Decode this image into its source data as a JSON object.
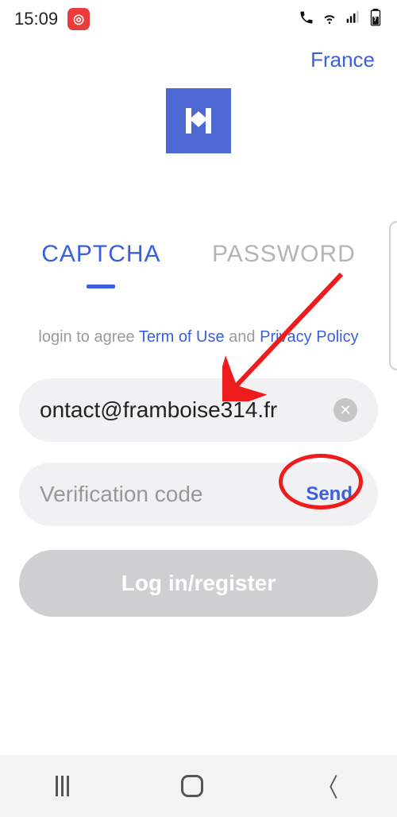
{
  "status": {
    "time": "15:09"
  },
  "top": {
    "region": "France"
  },
  "tabs": {
    "captcha": "CAPTCHA",
    "password": "PASSWORD"
  },
  "agree": {
    "prefix": "login to agree ",
    "terms": "Term of Use",
    "mid": " and ",
    "privacy": "Privacy Policy"
  },
  "email": {
    "value": "ontact@framboise314.fr"
  },
  "code": {
    "placeholder": "Verification code",
    "send": "Send"
  },
  "login": {
    "label": "Log in/register"
  }
}
